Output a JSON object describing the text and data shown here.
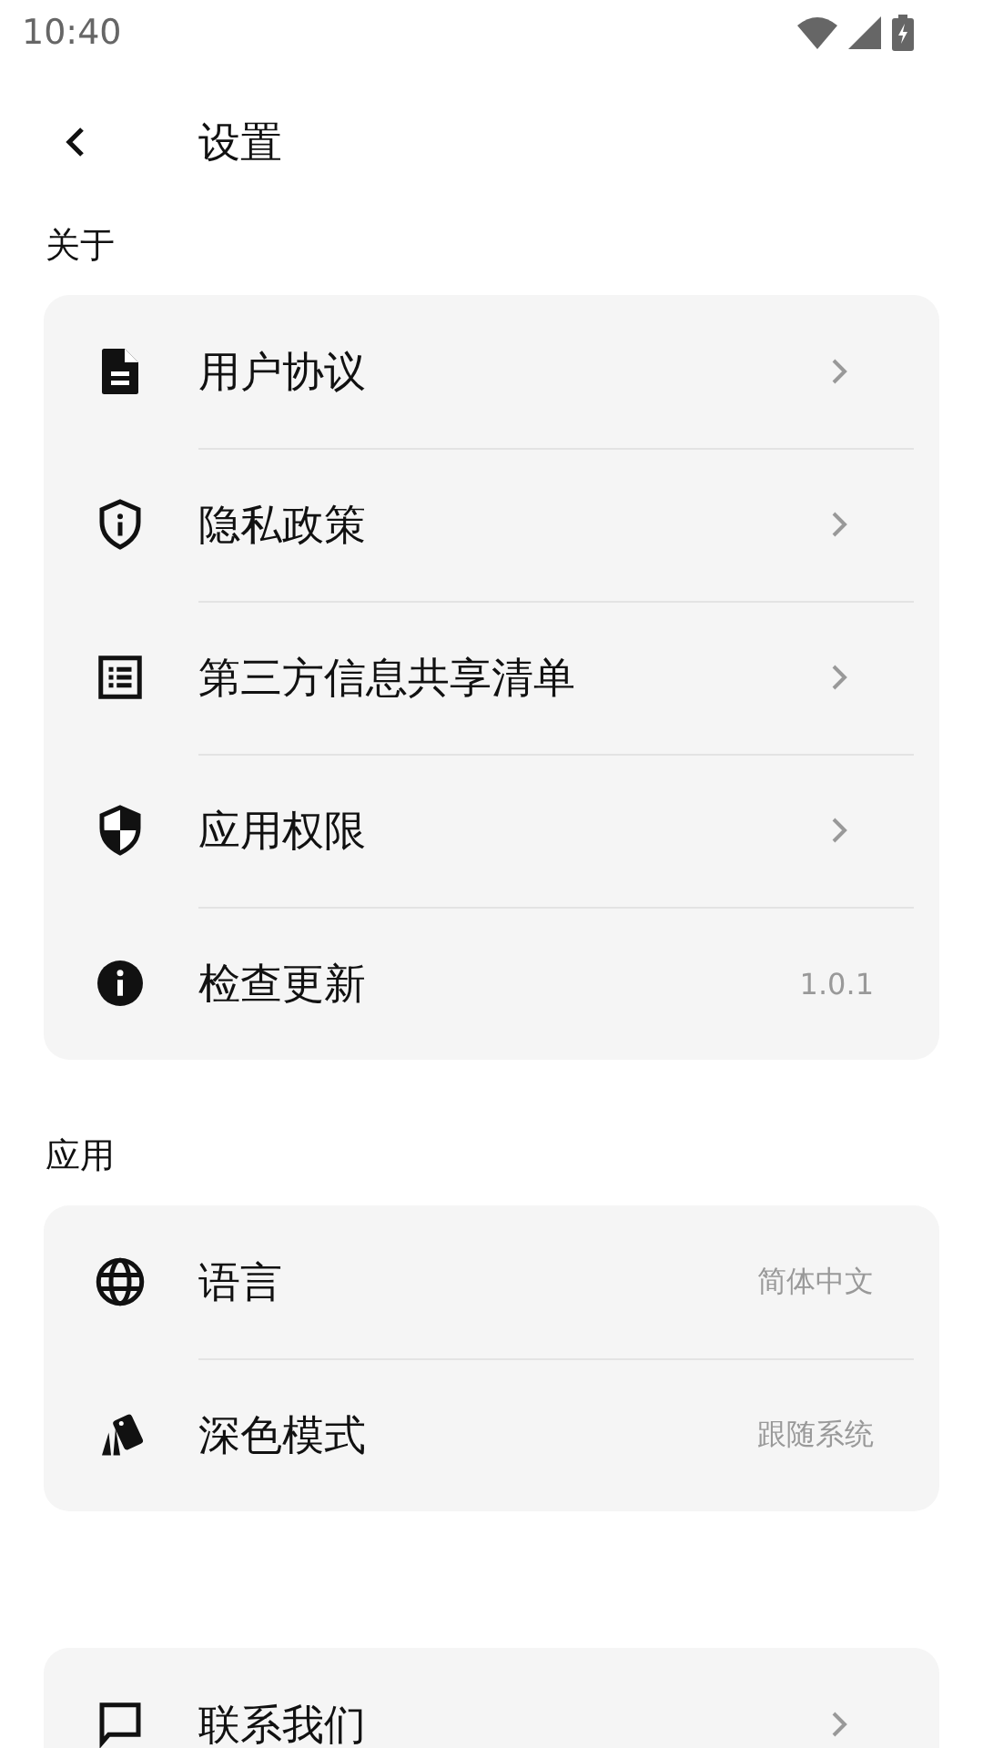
{
  "status_bar": {
    "time": "10:40"
  },
  "header": {
    "title": "设置"
  },
  "sections": [
    {
      "title": "关于",
      "items": [
        {
          "label": "用户协议",
          "kind": "chevron"
        },
        {
          "label": "隐私政策",
          "kind": "chevron"
        },
        {
          "label": "第三方信息共享清单",
          "kind": "chevron"
        },
        {
          "label": "应用权限",
          "kind": "chevron"
        },
        {
          "label": "检查更新",
          "kind": "value",
          "value": "1.0.1"
        }
      ]
    },
    {
      "title": "应用",
      "items": [
        {
          "label": "语言",
          "kind": "value",
          "value": "简体中文"
        },
        {
          "label": "深色模式",
          "kind": "value",
          "value": "跟随系统"
        }
      ]
    },
    {
      "items": [
        {
          "label": "联系我们",
          "kind": "chevron"
        }
      ]
    }
  ]
}
